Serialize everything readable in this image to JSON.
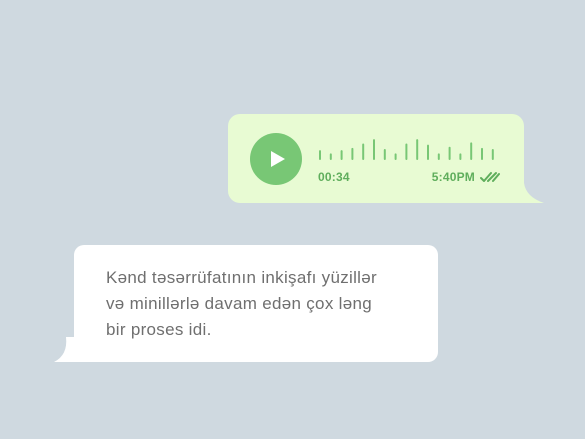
{
  "colors": {
    "background": "#cfd9e0",
    "outgoing_bubble": "#e8fbd3",
    "accent_green": "#78c775",
    "incoming_bubble": "#ffffff",
    "message_text": "#6f6f6f"
  },
  "voice_message": {
    "play_icon": "play-icon",
    "duration": "00:34",
    "sent_time": "5:40PM",
    "status_icon": "double-check-icon",
    "waveform_levels": [
      0.45,
      0.3,
      0.45,
      0.55,
      0.75,
      0.95,
      0.5,
      0.3,
      0.75,
      0.95,
      0.7,
      0.3,
      0.6,
      0.3,
      0.8,
      0.55,
      0.5
    ]
  },
  "text_message": {
    "lines": [
      "Kənd təsərrüfatının inkişafı yüzillər",
      "və minillərlə davam edən çox ləng",
      "bir proses idi."
    ]
  }
}
